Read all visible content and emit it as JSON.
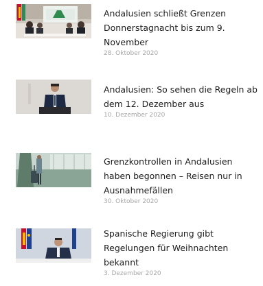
{
  "articles": [
    {
      "title": "Andalusien schließt Grenzen Donnerstagnacht bis zum 9. November",
      "date": "28. Oktober 2020",
      "image": "government-meeting-photo"
    },
    {
      "title": "Andalusien: So sehen die Regeln ab dem 12. Dezember aus",
      "date": "10. Dezember 2020",
      "image": "politician-at-podium-photo"
    },
    {
      "title": "Grenzkontrollen in Andalusien haben begonnen – Reisen nur in Ausnahmefällen",
      "date": "30. Oktober 2020",
      "image": "traveler-with-suitcase-photo"
    },
    {
      "title": "Spanische Regierung gibt Regelungen für Weihnachten bekannt",
      "date": "3. Dezember 2020",
      "image": "minister-with-flags-photo"
    }
  ],
  "colors": {
    "title": "#1c1c1c",
    "date": "#a6a6a6",
    "background": "#ffffff"
  }
}
